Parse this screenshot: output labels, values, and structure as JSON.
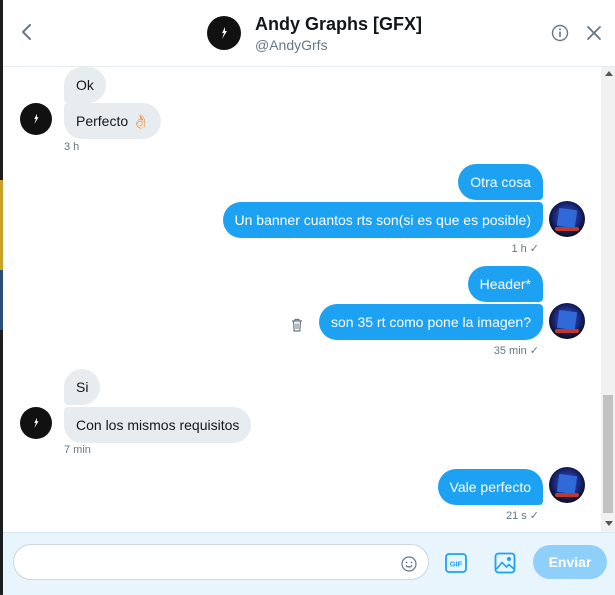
{
  "header": {
    "title": "Andy Graphs [GFX]",
    "handle": "@AndyGrfs",
    "icons": [
      "back-arrow-icon",
      "info-icon",
      "close-icon"
    ]
  },
  "messages": [
    {
      "side": "in",
      "text": "Ok"
    },
    {
      "side": "in",
      "text": "Perfecto 👌🏻"
    },
    {
      "side": "in-meta",
      "text": "3 h"
    },
    {
      "side": "out",
      "text": "Otra cosa"
    },
    {
      "side": "out",
      "text": "Un banner cuantos rts son(si es que es posible)"
    },
    {
      "side": "out-meta",
      "text": "1 h"
    },
    {
      "side": "out",
      "text": "Header*"
    },
    {
      "side": "out",
      "text": "son 35 rt como pone la imagen?"
    },
    {
      "side": "out-meta",
      "text": "35 min"
    },
    {
      "side": "in",
      "text": "Si"
    },
    {
      "side": "in",
      "text": "Con los mismos requisitos"
    },
    {
      "side": "in-meta",
      "text": "7 min"
    },
    {
      "side": "out",
      "text": "Vale perfecto"
    },
    {
      "side": "out-meta",
      "text": "21 s"
    }
  ],
  "read_mark": "✓",
  "compose": {
    "placeholder": "",
    "gif_label": "GIF",
    "send_label": "Enviar"
  },
  "colors": {
    "accent": "#1da1f2",
    "incoming_bubble": "#e6ecf0",
    "send_disabled": "#8ed0f9"
  }
}
